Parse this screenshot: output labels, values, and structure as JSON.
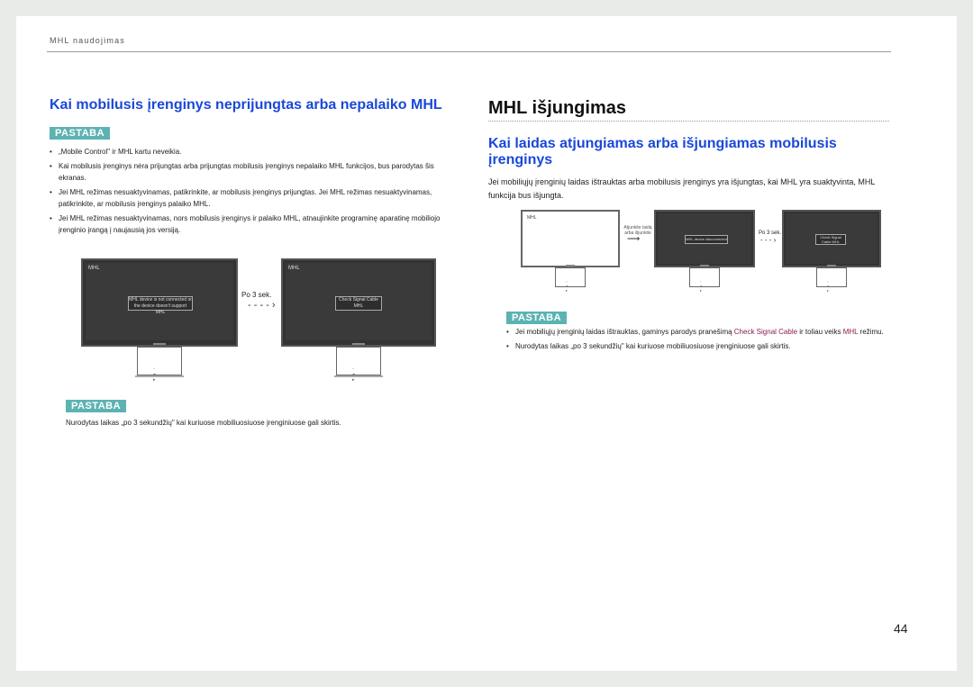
{
  "header": {
    "section": "MHL naudojimas"
  },
  "left": {
    "title": "Kai mobilusis įrenginys neprijungtas arba nepalaiko MHL",
    "note_badge": "PASTABA",
    "bullets": [
      "„Mobile Control\" ir MHL kartu neveikia.",
      "Kai mobilusis įrenginys nėra prijungtas arba prijungtas mobilusis įrenginys nepalaiko MHL funkcijos, bus parodytas šis ekranas.",
      "Jei MHL režimas nesuaktyvinamas, patikrinkite, ar mobilusis įrenginys prijungtas. Jei MHL režimas nesuaktyvinamas, patikrinkite, ar mobilusis įrenginys palaiko MHL.",
      "Jei MHL režimas nesuaktyvinamas, nors mobilusis įrenginys ir palaiko MHL, atnaujinkite programinę aparatinę mobiliojo įrenginio įrangą į naujausią jos versiją."
    ],
    "illustration": {
      "monitor1_label": "MHL",
      "monitor1_msg": "MHL device is not connected or the device doesn't support MHL",
      "arrow_label": "Po 3 sek.",
      "monitor2_label": "MHL",
      "monitor2_msg": "Check Signal Cable MHL"
    },
    "note2_badge": "PASTABA",
    "note2_text": "Nurodytas laikas „po 3 sekundžių\" kai kuriuose mobiliuosiuose įrenginiuose gali skirtis."
  },
  "right": {
    "title": "MHL išjungimas",
    "subtitle": "Kai laidas atjungiamas arba išjungiamas mobilusis įrenginys",
    "body": "Jei mobiliųjų įrenginių laidas ištrauktas arba mobilusis įrenginys yra išjungtas, kai MHL yra suaktyvinta, MHL funkcija bus išjungta.",
    "illustration": {
      "monitor1_label": "MHL",
      "arrow1_label": "Atjunkite laidą arba išjunkite",
      "monitor2_msg": "MHL device disconnected",
      "arrow2_label": "Po 3 sek.",
      "monitor3_msg": "Check Signal Cable MHL"
    },
    "note_badge": "PASTABA",
    "bullet1_pre": "Jei mobiliųjų įrenginių laidas ištrauktas, gaminys parodys pranešimą ",
    "bullet1_hl": "Check Signal Cable",
    "bullet1_mid": " ir toliau veiks ",
    "bullet1_hl2": "MHL",
    "bullet1_post": " režimu.",
    "bullet2": "Nurodytas laikas „po 3 sekundžių\" kai kuriuose mobiliuosiuose įrenginiuose gali skirtis."
  },
  "page_number": "44"
}
